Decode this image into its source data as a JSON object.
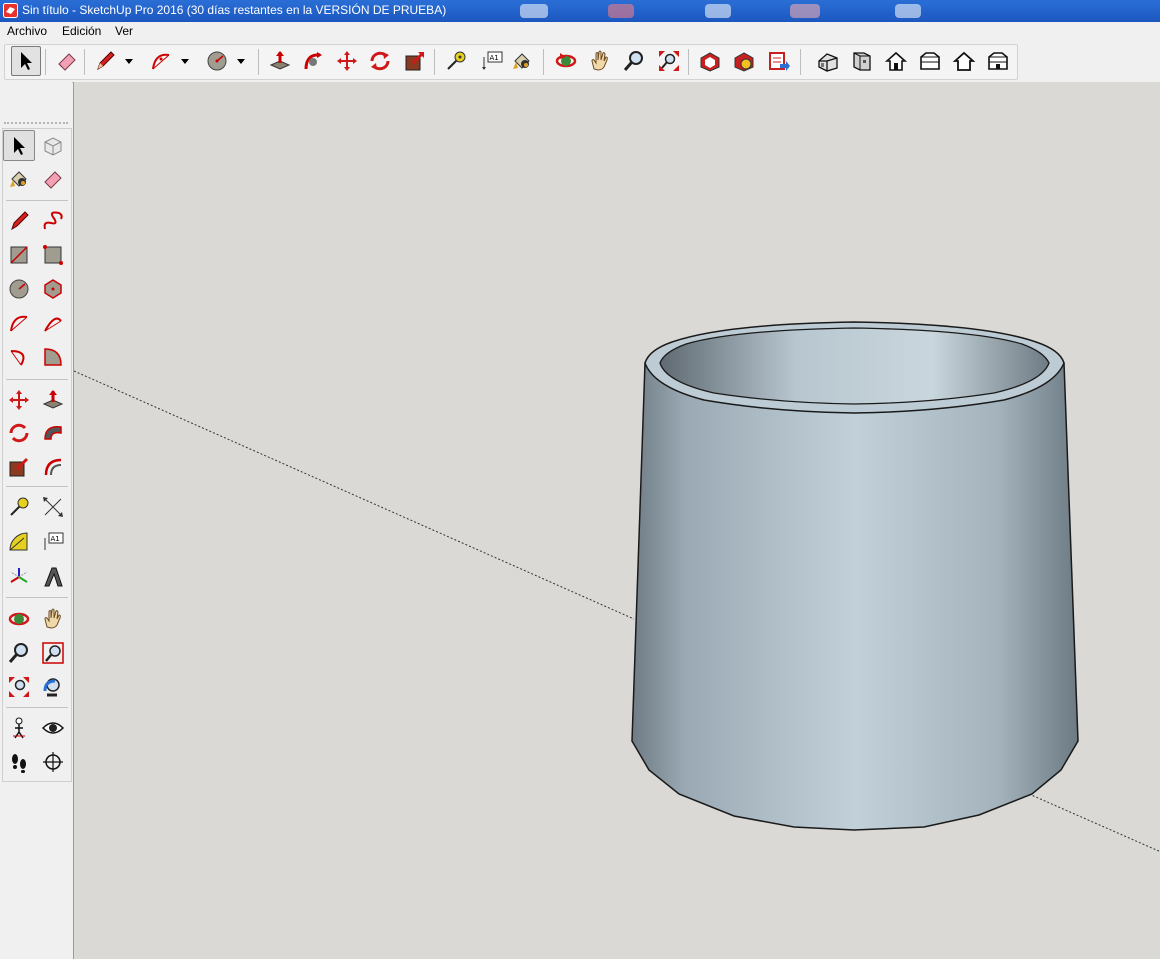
{
  "window": {
    "title": "Sin título - SketchUp Pro 2016 (30 días restantes en la VERSIÓN DE PRUEBA)"
  },
  "menu": {
    "items": [
      "Archivo",
      "Edición",
      "Ver"
    ]
  },
  "top_toolbar": {
    "tools": [
      "select",
      "eraser",
      "pencil",
      "arc",
      "circle",
      "push-pull",
      "follow-me",
      "move",
      "rotate",
      "scale",
      "tape-measure",
      "text",
      "paint-bucket",
      "orbit",
      "pan",
      "zoom",
      "zoom-extents",
      "3d-warehouse",
      "extension-warehouse",
      "layout",
      "iso-view",
      "front-view",
      "top-view",
      "home",
      "right-view",
      "back-view"
    ]
  },
  "left_toolbar": {
    "tools": [
      "select",
      "make-component",
      "paint-bucket",
      "eraser",
      "pencil",
      "freehand",
      "rectangle",
      "rotated-rectangle",
      "circle",
      "polygon",
      "arc",
      "arc-2pt",
      "arc-3pt",
      "pie",
      "move",
      "push-pull",
      "rotate",
      "follow-me",
      "scale",
      "offset",
      "tape-measure",
      "dimension",
      "protractor",
      "text",
      "axes",
      "3d-text",
      "orbit",
      "pan",
      "zoom",
      "zoom-window",
      "zoom-extents",
      "previous-view",
      "position-camera",
      "look-around",
      "walk",
      "section-plane"
    ]
  },
  "colors": {
    "titlebar": "#1c57c0",
    "viewport": "#dad9d6",
    "model_fill": "#bccad3",
    "model_edge": "#1a1a1a"
  }
}
